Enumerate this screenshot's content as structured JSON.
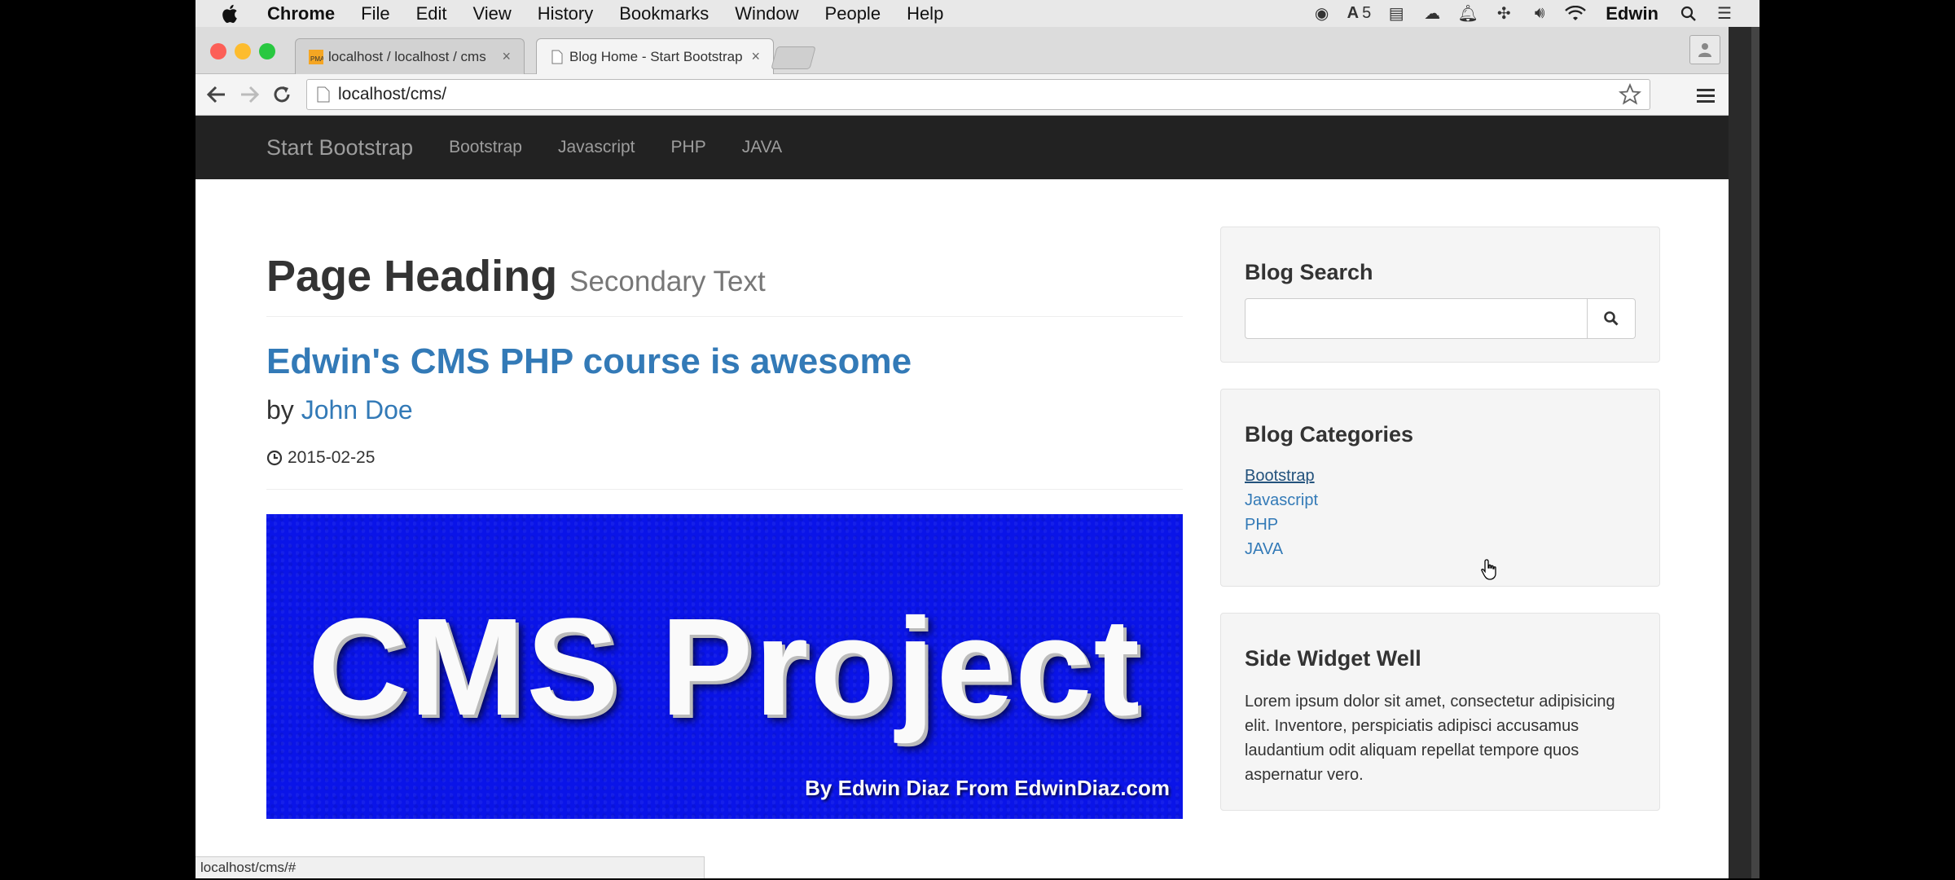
{
  "menubar": {
    "app_name": "Chrome",
    "items": [
      "File",
      "Edit",
      "View",
      "History",
      "Bookmarks",
      "Window",
      "People",
      "Help"
    ],
    "adobe_count": "5",
    "user": "Edwin"
  },
  "browser": {
    "tabs": [
      {
        "title": "localhost / localhost / cms"
      },
      {
        "title": "Blog Home - Start Bootstrap"
      }
    ],
    "url": "localhost/cms/",
    "status_url": "localhost/cms/#"
  },
  "site": {
    "brand": "Start Bootstrap",
    "nav": [
      "Bootstrap",
      "Javascript",
      "PHP",
      "JAVA"
    ]
  },
  "main": {
    "heading": "Page Heading",
    "heading_small": "Secondary Text",
    "post_title": "Edwin's CMS PHP course is awesome",
    "by_label": "by",
    "author": "John Doe",
    "date": "2015-02-25",
    "banner_title": "CMS Project",
    "banner_byline": "By Edwin Diaz From EdwinDiaz.com"
  },
  "sidebar": {
    "search_title": "Blog Search",
    "search_value": "",
    "categories_title": "Blog Categories",
    "categories": [
      "Bootstrap",
      "Javascript",
      "PHP",
      "JAVA"
    ],
    "widget_title": "Side Widget Well",
    "widget_text": "Lorem ipsum dolor sit amet, consectetur adipisicing elit. Inventore, perspiciatis adipisci accusamus laudantium odit aliquam repellat tempore quos aspernatur vero."
  },
  "colors": {
    "link": "#337ab7",
    "navbar": "#222222",
    "banner": "#0a14e8"
  }
}
